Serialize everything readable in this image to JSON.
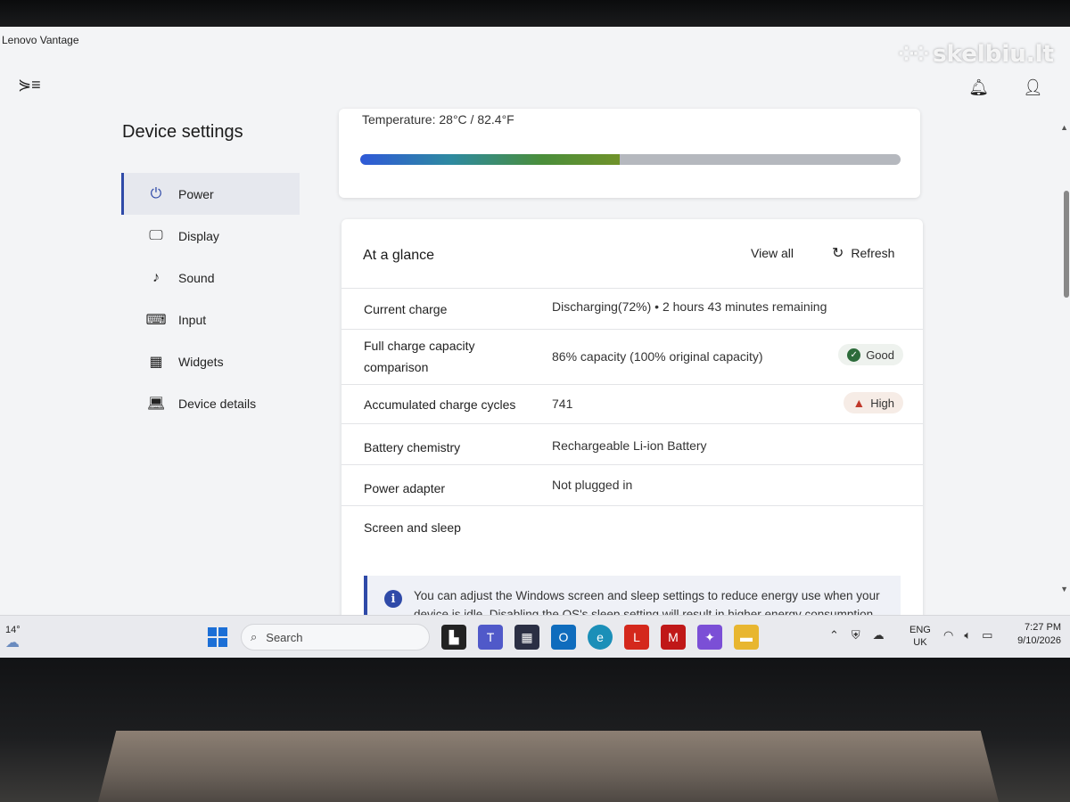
{
  "window": {
    "title": "Lenovo Vantage"
  },
  "watermark": {
    "text": "skelbiu.lt"
  },
  "header": {
    "menu_icon": "menu-toggle-icon",
    "notification_icon": "bell-icon",
    "account_icon": "user-icon"
  },
  "page": {
    "title": "Device settings"
  },
  "sidebar": {
    "items": [
      {
        "label": "Power",
        "icon": "plug-icon",
        "active": true
      },
      {
        "label": "Display",
        "icon": "monitor-icon"
      },
      {
        "label": "Sound",
        "icon": "music-note-icon"
      },
      {
        "label": "Input",
        "icon": "keyboard-icon"
      },
      {
        "label": "Widgets",
        "icon": "widgets-icon"
      },
      {
        "label": "Device details",
        "icon": "laptop-icon"
      }
    ]
  },
  "temperature": {
    "label": "Temperature:  28°C / 82.4°F",
    "level": 0.48
  },
  "glance": {
    "title": "At a glance",
    "view_all": "View all",
    "refresh": "Refresh",
    "rows": [
      {
        "label": "Current charge",
        "value": "Discharging(72%)  •  2 hours 43 minutes remaining"
      },
      {
        "label": "Full charge capacity comparison",
        "value": "86% capacity (100% original capacity)",
        "badge": "Good",
        "badge_type": "good"
      },
      {
        "label": "Accumulated charge cycles",
        "value": "741",
        "badge": "High",
        "badge_type": "warning"
      },
      {
        "label": "Battery chemistry",
        "value": "Rechargeable Li-ion Battery"
      },
      {
        "label": "Power adapter",
        "value": "Not plugged in"
      }
    ],
    "section": "Screen and sleep",
    "info": "You can adjust the Windows screen and sleep settings to reduce energy use when your device is idle. Disabling the OS's sleep setting will result in higher energy consumption. We recommend that you keep the sleep setting enabled, as this will automatically"
  },
  "taskbar": {
    "weather": "14°",
    "search_placeholder": "Search",
    "apps": [
      "file-explorer-dark-icon",
      "teams-icon",
      "store-icon",
      "outlook-icon",
      "edge-icon",
      "lenovo-vantage-icon",
      "mcafee-icon",
      "copilot-icon",
      "folder-icon"
    ],
    "lang_top": "ENG",
    "lang_bottom": "UK",
    "time": "7:27 PM",
    "date": "9/10/2026"
  },
  "colors": {
    "accent": "#2f4aa8",
    "good": "#2c6b3a",
    "warning": "#c0392b",
    "windows_blue": "#1c6fd6"
  }
}
